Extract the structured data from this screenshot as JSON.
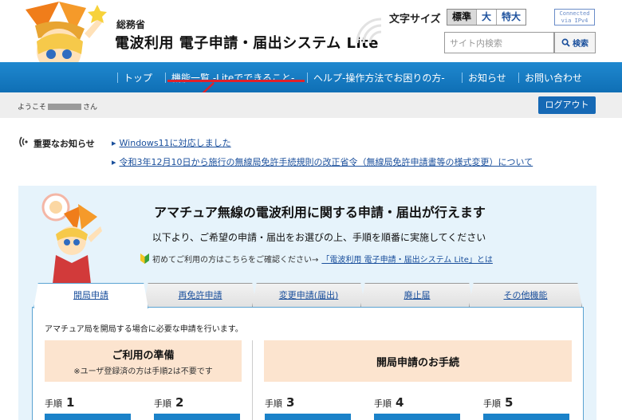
{
  "header": {
    "ministry": "総務省",
    "title": "電波利用 電子申請・届出システム Lite",
    "font_size_label": "文字サイズ",
    "font_size_options": [
      "標準",
      "大",
      "特大"
    ],
    "font_size_selected": "標準",
    "ipv4_badge_line1": "Connected",
    "ipv4_badge_line2": "via IPv4",
    "search_placeholder": "サイト内検索",
    "search_button": "検索"
  },
  "nav": {
    "items": [
      "トップ",
      "機能一覧 -Liteでできること-",
      "ヘルプ-操作方法でお困りの方-",
      "お知らせ",
      "お問い合わせ"
    ]
  },
  "user_bar": {
    "welcome_prefix": "ようこそ",
    "welcome_suffix": "さん",
    "logout": "ログアウト"
  },
  "news": {
    "title": "重要なお知らせ",
    "items": [
      "Windows11に対応しました",
      "令和3年12月10日から施行の無線局免許手続規則の改正省令（無線局免許申請書等の様式変更）について"
    ]
  },
  "main": {
    "heading": "アマチュア無線の電波利用に関する申請・届出が行えます",
    "subheading": "以下より、ご希望の申請・届出をお選びの上、手順を順番に実施してください",
    "first_time_text": "初めてご利用の方はこちらをご確認ください→",
    "first_time_link": "「電波利用 電子申請・届出システム Lite」とは",
    "tabs": [
      "開局申請",
      "再免許申請",
      "変更申請(届出)",
      "廃止届",
      "その他機能"
    ],
    "active_tab": "開局申請",
    "tab_description": "アマチュア局を開局する場合に必要な申請を行います。",
    "preparation_title": "ご利用の準備",
    "preparation_note": "※ユーザ登録済の方は手順2は不要です",
    "procedure_title": "開局申請のお手続",
    "step_label": "手順",
    "steps": [
      "1",
      "2",
      "3",
      "4",
      "5"
    ]
  },
  "colors": {
    "nav_blue": "#1f88cf",
    "accent_red": "#e0212a",
    "panel_bg": "#e6f3fb",
    "step_box": "#fce4cf",
    "link_blue": "#1a4f9c"
  }
}
